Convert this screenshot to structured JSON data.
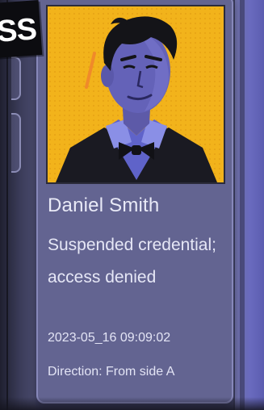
{
  "badge": {
    "text": "SS"
  },
  "card": {
    "name": "Daniel Smith",
    "status": "Suspended credential; access denied",
    "timestamp": "2023-05_16  09:09:02",
    "direction": "Direction: From side A"
  },
  "colors": {
    "card_background": "#636491",
    "card_border": "#8788ba",
    "portrait_background": "#f2b31b",
    "accent_right": "#6a6bbf",
    "badge_background": "#0c0c10",
    "text": "#e9eaf7"
  },
  "icons": {
    "portrait": "user-portrait-image"
  }
}
